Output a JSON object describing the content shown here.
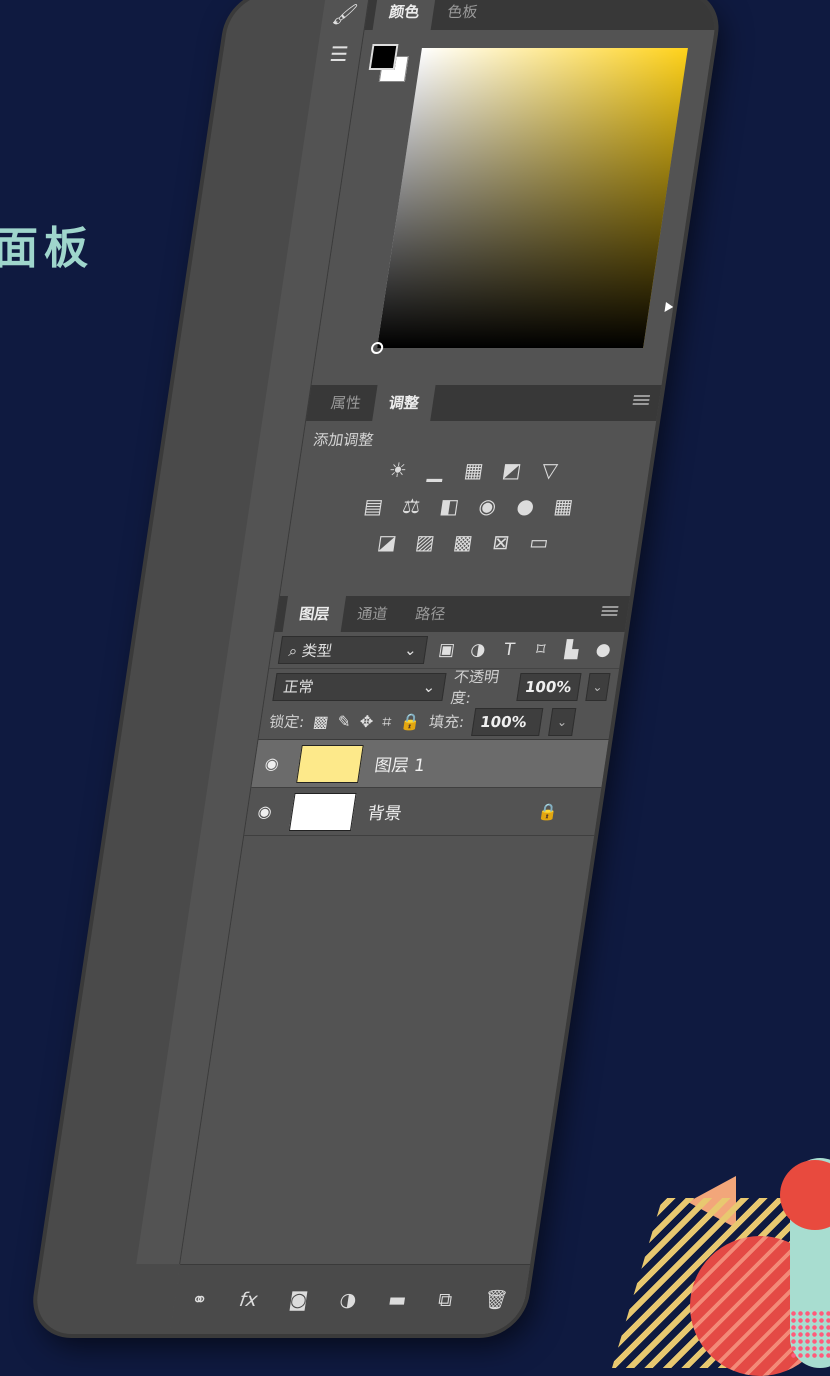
{
  "slide": {
    "title": "面板"
  },
  "colors": {
    "background": "#0f1a40",
    "panel": "#535353",
    "accent_yellow": "#ffd21a"
  },
  "color_panel": {
    "tabs": [
      "颜色",
      "色板"
    ],
    "foreground": "#000000",
    "background_swatch": "#ffffff"
  },
  "adjustments_panel": {
    "tabs": [
      "属性",
      "调整"
    ],
    "add_label": "添加调整",
    "rows": [
      [
        "brightness-icon",
        "levels-icon",
        "curves-icon",
        "exposure-icon",
        "vibrance-icon"
      ],
      [
        "hue-saturation-icon",
        "color-balance-icon",
        "black-white-icon",
        "photo-filter-icon",
        "channel-mixer-icon",
        "color-lookup-icon"
      ],
      [
        "invert-icon",
        "posterize-icon",
        "threshold-icon",
        "selective-color-icon",
        "gradient-map-icon"
      ]
    ]
  },
  "layers_panel": {
    "tabs": [
      "图层",
      "通道",
      "路径"
    ],
    "filter_label": "类型",
    "blend_mode": "正常",
    "opacity_label": "不透明度:",
    "opacity_value": "100%",
    "lock_label": "锁定:",
    "fill_label": "填充:",
    "fill_value": "100%",
    "layers": [
      {
        "name": "图层 1",
        "thumb": "#fde98a",
        "selected": true
      },
      {
        "name": "背景",
        "thumb": "#ffffff",
        "locked": true
      }
    ]
  },
  "bottom_bar": [
    "link-icon",
    "fx-icon",
    "mask-icon",
    "adjustment-icon",
    "folder-icon",
    "new-layer-icon",
    "trash-icon"
  ],
  "bottom_bar_fx": "fx"
}
